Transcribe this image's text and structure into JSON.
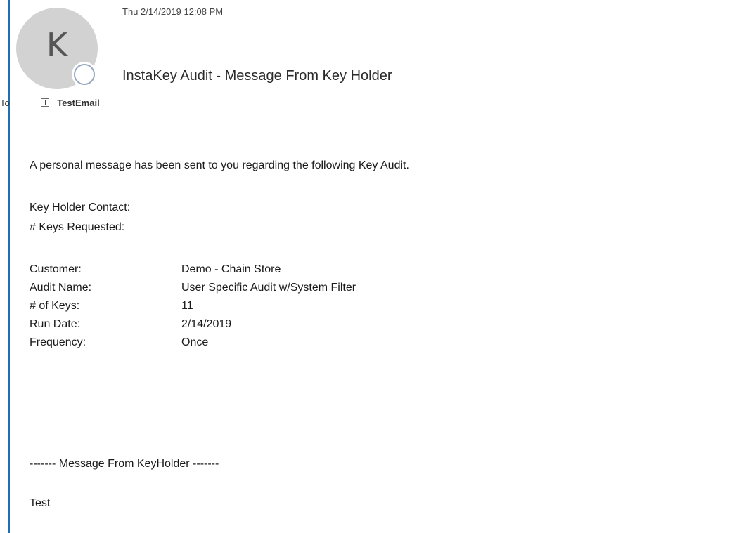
{
  "header": {
    "avatar_initial": "K",
    "date": "Thu 2/14/2019 12:08 PM",
    "subject": "InstaKey Audit - Message From Key Holder",
    "to_label": "To",
    "recipient": "_TestEmail"
  },
  "body": {
    "intro": "A personal message has been sent to you regarding the following Key Audit.",
    "key_holder_contact_label": "Key Holder Contact:",
    "keys_requested_label": "# Keys Requested:",
    "details": [
      {
        "label": "Customer:",
        "value": "Demo - Chain Store"
      },
      {
        "label": "Audit Name:",
        "value": "User Specific Audit w/System Filter"
      },
      {
        "label": "# of Keys:",
        "value": "11"
      },
      {
        "label": "Run Date:",
        "value": "2/14/2019"
      },
      {
        "label": "Frequency:",
        "value": "Once"
      }
    ],
    "message_separator": "------- Message From KeyHolder -------",
    "message": "Test"
  },
  "colors": {
    "left_rule": "#1f6fb0",
    "avatar_bg": "#d2d2d2",
    "presence_ring": "#96a8c2"
  },
  "icons": {
    "presence": "presence-status-icon",
    "expand": "expand-plus-icon"
  }
}
